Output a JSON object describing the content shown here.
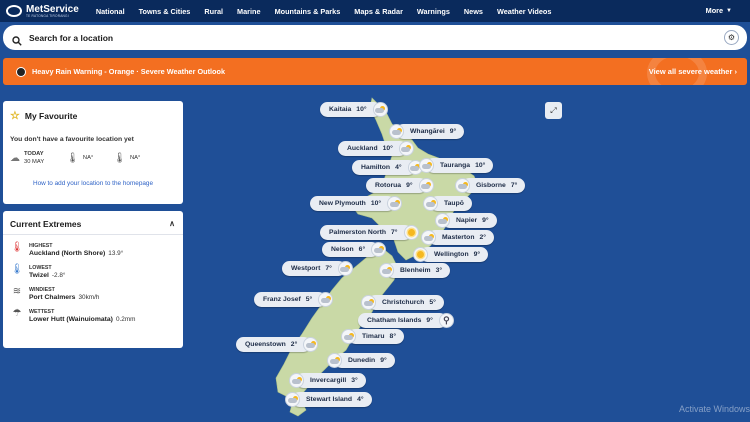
{
  "nav": {
    "brand": "MetService",
    "brand_sub": "TE RATONGA TIRORANGI",
    "links": [
      "National",
      "Towns & Cities",
      "Rural",
      "Marine",
      "Mountains & Parks",
      "Maps & Radar",
      "Warnings",
      "News",
      "Weather Videos"
    ],
    "more": "More"
  },
  "search": {
    "placeholder": "Search for a location"
  },
  "warning": {
    "text": "Heavy Rain Warning - Orange · Severe Weather Outlook",
    "link": "View all severe weather"
  },
  "favourite": {
    "title": "My Favourite",
    "message": "You don't have a favourite location yet",
    "today_label": "TODAY",
    "today_date": "30 MAY",
    "na1": "NA°",
    "na2": "NA°",
    "link": "How to add your location to the homepage"
  },
  "extremes": {
    "title": "Current Extremes",
    "items": [
      {
        "label": "HIGHEST",
        "location": "Auckland (North Shore)",
        "value": "13.9°"
      },
      {
        "label": "LOWEST",
        "location": "Twizel",
        "value": "-2.8°"
      },
      {
        "label": "WINDIEST",
        "location": "Port Chalmers",
        "value": "30km/h"
      },
      {
        "label": "WETTEST",
        "location": "Lower Hutt (Wainuiomata)",
        "value": "0.2mm"
      }
    ]
  },
  "cities": [
    {
      "name": "Kaitaia",
      "temp": "10°",
      "icon": "cloud-sun-icon"
    },
    {
      "name": "Whangārei",
      "temp": "9°",
      "icon": "cloud-sun-icon"
    },
    {
      "name": "Auckland",
      "temp": "10°",
      "icon": "cloud-sun-icon"
    },
    {
      "name": "Hamilton",
      "temp": "4°",
      "icon": "cloud-sun-icon"
    },
    {
      "name": "Tauranga",
      "temp": "10°",
      "icon": "cloud-sun-icon"
    },
    {
      "name": "Rotorua",
      "temp": "9°",
      "icon": "cloud-sun-icon"
    },
    {
      "name": "Gisborne",
      "temp": "7°",
      "icon": "cloud-sun-icon"
    },
    {
      "name": "New Plymouth",
      "temp": "10°",
      "icon": "cloud-sun-icon"
    },
    {
      "name": "Taupō",
      "temp": "",
      "icon": "cloud-sun-icon"
    },
    {
      "name": "Napier",
      "temp": "9°",
      "icon": "cloud-sun-icon"
    },
    {
      "name": "Palmerston North",
      "temp": "7°",
      "icon": "sun-icon"
    },
    {
      "name": "Masterton",
      "temp": "2°",
      "icon": "cloud-sun-icon"
    },
    {
      "name": "Nelson",
      "temp": "6°",
      "icon": "cloud-sun-icon"
    },
    {
      "name": "Wellington",
      "temp": "9°",
      "icon": "sun-icon"
    },
    {
      "name": "Westport",
      "temp": "7°",
      "icon": "cloud-sun-icon"
    },
    {
      "name": "Blenheim",
      "temp": "3°",
      "icon": "cloud-sun-icon"
    },
    {
      "name": "Franz Josef",
      "temp": "5°",
      "icon": "cloud-sun-icon"
    },
    {
      "name": "Christchurch",
      "temp": "5°",
      "icon": "cloud-sun-icon"
    },
    {
      "name": "Chatham Islands",
      "temp": "9°",
      "icon": "location-pin-icon"
    },
    {
      "name": "Timaru",
      "temp": "8°",
      "icon": "cloud-sun-icon"
    },
    {
      "name": "Queenstown",
      "temp": "2°",
      "icon": "cloud-sun-icon"
    },
    {
      "name": "Dunedin",
      "temp": "9°",
      "icon": "cloud-sun-icon"
    },
    {
      "name": "Invercargill",
      "temp": "3°",
      "icon": "cloud-sun-icon"
    },
    {
      "name": "Stewart Island",
      "temp": "4°",
      "icon": "cloud-sun-icon"
    }
  ],
  "watermark": "Activate Windows",
  "colors": {
    "nav": "#0a2a5c",
    "background": "#1f4f97",
    "warning": "#f36f21",
    "land": "#c9d9a6"
  }
}
